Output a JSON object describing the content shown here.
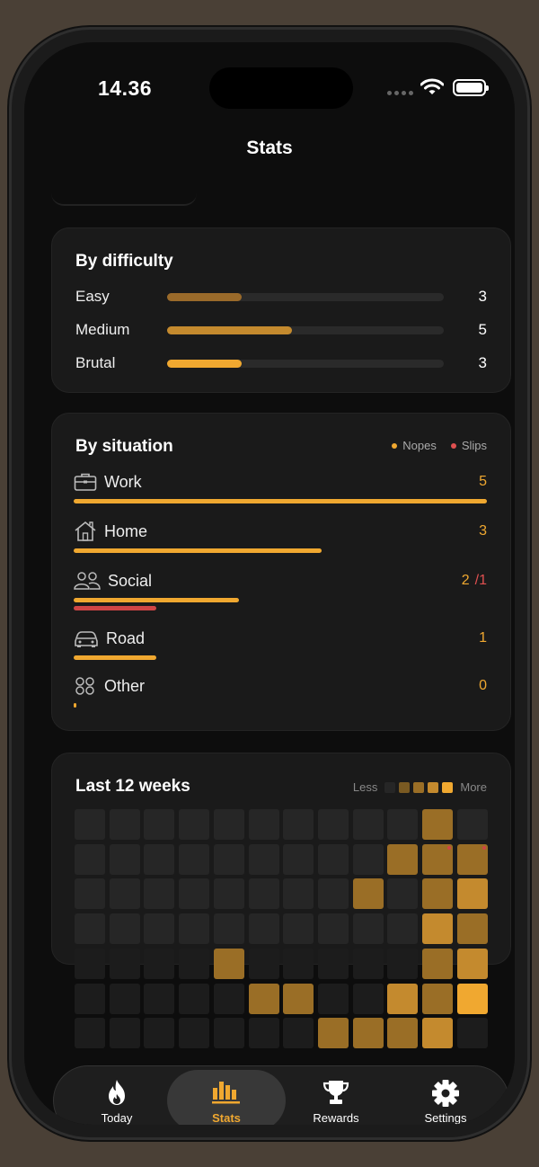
{
  "status": {
    "time": "14.36"
  },
  "header": {
    "title": "Stats"
  },
  "difficulty": {
    "title": "By difficulty",
    "rows": [
      {
        "label": "Easy",
        "value": "3",
        "fraction": 0.27,
        "color": "#9a6a2a"
      },
      {
        "label": "Medium",
        "value": "5",
        "fraction": 0.45,
        "color": "#c48a2e"
      },
      {
        "label": "Brutal",
        "value": "3",
        "fraction": 0.27,
        "color": "#f0a830"
      }
    ]
  },
  "situation": {
    "title": "By situation",
    "legend": {
      "nopes": "Nopes",
      "slips": "Slips"
    },
    "rows": [
      {
        "label": "Work",
        "icon": "briefcase-icon",
        "nopes": "5",
        "nope_fraction": 1.0
      },
      {
        "label": "Home",
        "icon": "house-icon",
        "nopes": "3",
        "nope_fraction": 0.6
      },
      {
        "label": "Social",
        "icon": "people-icon",
        "nopes": "2",
        "slips": "/1",
        "nope_fraction": 0.4,
        "slip_fraction": 0.2
      },
      {
        "label": "Road",
        "icon": "car-icon",
        "nopes": "1",
        "nope_fraction": 0.2
      },
      {
        "label": "Other",
        "icon": "circles-grid-icon",
        "nopes": "0",
        "nope_fraction": 0.0
      }
    ]
  },
  "weeks": {
    "title": "Last 12 weeks",
    "legend_less": "Less",
    "legend_more": "More",
    "levels": [
      "#262626",
      "#7a5a22",
      "#9a6e26",
      "#c48a2e",
      "#f0a830"
    ],
    "grid": [
      [
        0,
        0,
        0,
        0,
        0,
        0,
        0,
        0,
        0,
        0,
        2,
        0
      ],
      [
        0,
        0,
        0,
        0,
        0,
        0,
        0,
        0,
        0,
        2,
        2,
        2
      ],
      [
        0,
        0,
        0,
        0,
        0,
        0,
        0,
        0,
        2,
        0,
        2,
        3
      ],
      [
        0,
        0,
        0,
        0,
        0,
        0,
        0,
        0,
        0,
        0,
        3,
        2
      ],
      [
        0,
        0,
        0,
        0,
        2,
        0,
        0,
        0,
        0,
        0,
        2,
        3
      ],
      [
        0,
        0,
        0,
        0,
        0,
        2,
        2,
        0,
        0,
        3,
        2,
        4
      ],
      [
        0,
        0,
        0,
        0,
        0,
        0,
        0,
        2,
        2,
        2,
        3,
        0
      ]
    ],
    "slip_cells": [
      [
        1,
        10
      ],
      [
        1,
        11
      ]
    ]
  },
  "tabs": [
    {
      "label": "Today",
      "icon": "flame-icon"
    },
    {
      "label": "Stats",
      "icon": "bar-chart-icon",
      "active": true
    },
    {
      "label": "Rewards",
      "icon": "trophy-icon"
    },
    {
      "label": "Settings",
      "icon": "gear-icon"
    }
  ]
}
